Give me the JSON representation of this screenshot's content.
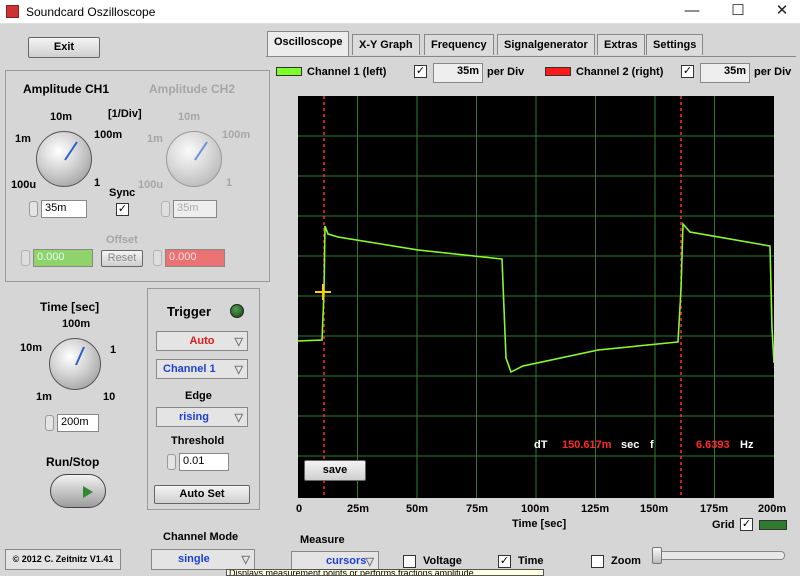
{
  "window": {
    "title": "Soundcard Oszilloscope",
    "minimize": "—",
    "maximize": "☐",
    "close": "✕"
  },
  "exit_label": "Exit",
  "copyright": "© 2012  C. Zeitnitz V1.41",
  "amp": {
    "ch1_title": "Amplitude CH1",
    "ch2_title": "Amplitude CH2",
    "unit": "[1/Div]",
    "scale": {
      "l10m": "10m",
      "l100m": "100m",
      "l1m": "1m",
      "l1": "1",
      "l100u": "100u"
    },
    "ch1_value": "35m",
    "ch2_value": "35m",
    "sync_label": "Sync",
    "sync_checked": "✓",
    "offset_label": "Offset",
    "offset_ch1": "0.000",
    "offset_ch2": "0.000",
    "reset_label": "Reset"
  },
  "time": {
    "title": "Time [sec]",
    "s100m": "100m",
    "s10m": "10m",
    "s1": "1",
    "s1m": "1m",
    "s10": "10",
    "value": "200m"
  },
  "runstop_label": "Run/Stop",
  "trigger": {
    "title": "Trigger",
    "mode": "Auto",
    "channel": "Channel 1",
    "edge_label": "Edge",
    "edge": "rising",
    "threshold_label": "Threshold",
    "threshold": "0.01",
    "autoset_label": "Auto Set"
  },
  "channel_mode": {
    "label": "Channel Mode",
    "value": "single"
  },
  "tabs": [
    "Oscilloscope",
    "X-Y Graph",
    "Frequency",
    "Signalgenerator",
    "Extras",
    "Settings"
  ],
  "channels": {
    "ch1_label": "Channel 1 (left)",
    "ch1_value": "35m",
    "ch1_checked": "✓",
    "ch2_label": "Channel 2 (right)",
    "ch2_value": "35m",
    "ch2_checked": "✓",
    "per_div": "per Div",
    "ch1_color": "#7cff2a",
    "ch2_color": "#ff1a1a"
  },
  "readout": {
    "dT_label": "dT",
    "dT_value": "150.617m",
    "dT_unit": "sec",
    "f_label": "f",
    "f_value": "6.6393",
    "f_unit": "Hz"
  },
  "save_label": "save",
  "x_ticks": [
    "0",
    "25m",
    "50m",
    "75m",
    "100m",
    "125m",
    "150m",
    "175m",
    "200m"
  ],
  "xlabel": "Time [sec]",
  "grid_label": "Grid",
  "grid_checked": "✓",
  "measure": {
    "label": "Measure",
    "mode": "cursors",
    "voltage_label": "Voltage",
    "time_label": "Time",
    "time_checked": "✓",
    "zoom_label": "Zoom"
  },
  "status_text": "Displays measurement points or performs fractions amplitude"
}
